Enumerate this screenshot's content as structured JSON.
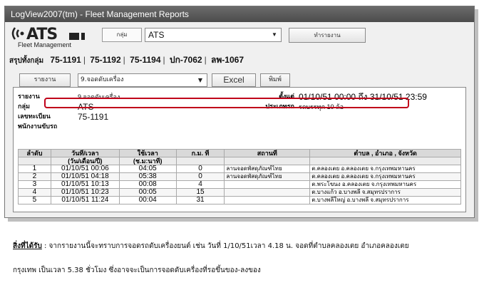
{
  "window": {
    "title": "LogView2007(tm) - Fleet Management Reports"
  },
  "logo": {
    "mark": "ATS",
    "subtitle": "Fleet Management"
  },
  "toolbar": {
    "group_label": "กลุ่ม",
    "group_value": "ATS",
    "run_button": "ทำรายงาน"
  },
  "tabs": {
    "summary_label": "สรุปทั้งกลุ่ม",
    "items": [
      "75-1191",
      "75-1192",
      "75-1194",
      "ปก-7062",
      "ลพ-1067"
    ]
  },
  "report_toolbar": {
    "report_button": "รายงาน",
    "report_select": "9.จอดดับเครื่อง",
    "excel_button": "Excel",
    "print_button": "พิมพ์"
  },
  "report_info": {
    "report_label": "รายงาน",
    "report_value": "9.จอดดับเครื่อง",
    "group_label": "กลุ่ม",
    "group_value": "ATS",
    "plate_label": "เลขทะเบียน",
    "plate_value": "75-1191",
    "driver_label": "พนักงานขับรถ",
    "driver_value": "",
    "from_label": "ตั้งแต่",
    "from_value": "01/10/51 00:00 ถึง 31/10/51 23:59",
    "type_label": "ประเภทรถ",
    "type_value": "รถบรรทุก 10 ล้อ"
  },
  "table": {
    "headers": [
      "ลำดับ",
      "วันที่/เวลา",
      "ใช้เวลา",
      "ก.ม. ที่",
      "สถานที่",
      "ตำบล , อำเภอ , จังหวัด"
    ],
    "subheaders": [
      "",
      "(วัน/เดือน/ปี)",
      "(ช.ม:นาที)",
      "",
      "",
      ""
    ],
    "rows": [
      [
        "1",
        "01/10/51 00:06",
        "04:05",
        "0",
        "ลานจอดพัสดุภัณฑ์ไทย",
        "ต.คลองเตย อ.คลองเตย จ.กรุงเทพมหานคร"
      ],
      [
        "2",
        "01/10/51 04:18",
        "05:38",
        "0",
        "ลานจอดพัสดุภัณฑ์ไทย",
        "ต.คลองเตย อ.คลองเตย จ.กรุงเทพมหานคร"
      ],
      [
        "3",
        "01/10/51 10:13",
        "00:08",
        "4",
        "",
        "ต.พระโขนง อ.คลองเตย จ.กรุงเทพมหานคร"
      ],
      [
        "4",
        "01/10/51 10:23",
        "00:05",
        "15",
        "",
        "ต.บางแก้ว อ.บางพลี จ.สมุทรปราการ"
      ],
      [
        "5",
        "01/10/51 11:24",
        "00:04",
        "31",
        "",
        "ต.บางพลีใหญ่ อ.บางพลี จ.สมุทรปราการ"
      ]
    ]
  },
  "caption": {
    "heading": "สิ่งที่ได้รับ",
    "line1": " : จากรายงานนี้จะทราบการจอดรถดับเครื่องยนต์ เช่น วันที่ 1/10/51เวลา 4.18 น. จอดที่ตำบลคลองเตย อำเภอคลองเตย",
    "line2": "กรุงเทพ เป็นเวลา 5.38 ชั่วโมง ซึ่งอาจจะเป็นการจอดดับเครื่องที่รอขึ้นของ-ลงของ"
  }
}
